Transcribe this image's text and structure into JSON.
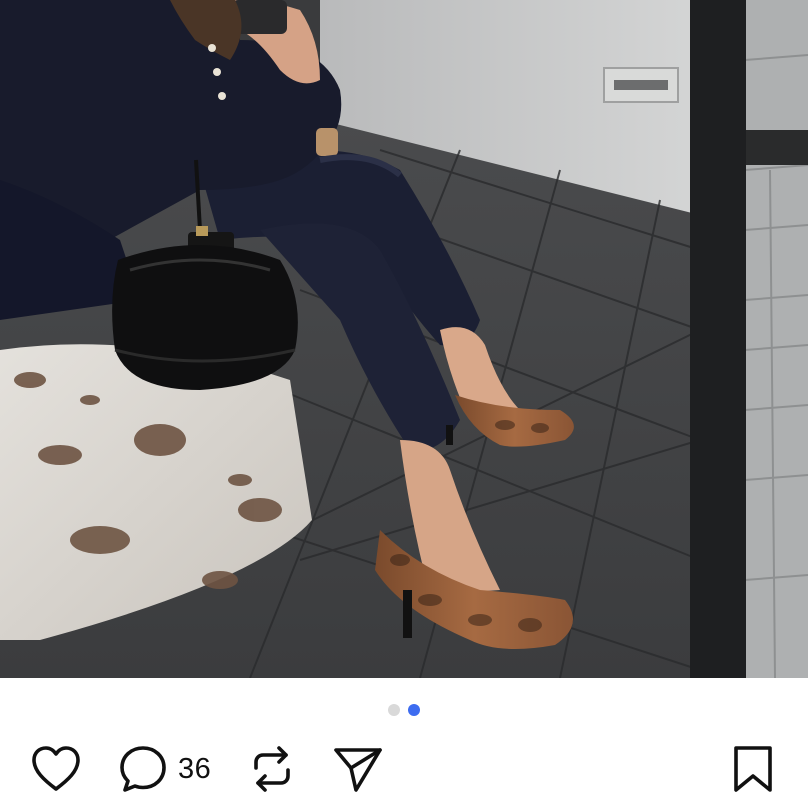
{
  "post": {
    "photo_alt": "",
    "carousel": {
      "total": 2,
      "active_index": 1
    },
    "actions": {
      "like_icon": "heart-icon",
      "comment_icon": "comment-bubble-icon",
      "comment_count": "36",
      "repost_icon": "repost-icon",
      "share_icon": "send-icon",
      "save_icon": "bookmark-icon"
    }
  },
  "colors": {
    "active_dot": "#3d6cf0",
    "inactive_dot": "#d9d9d9",
    "icon": "#111111"
  }
}
